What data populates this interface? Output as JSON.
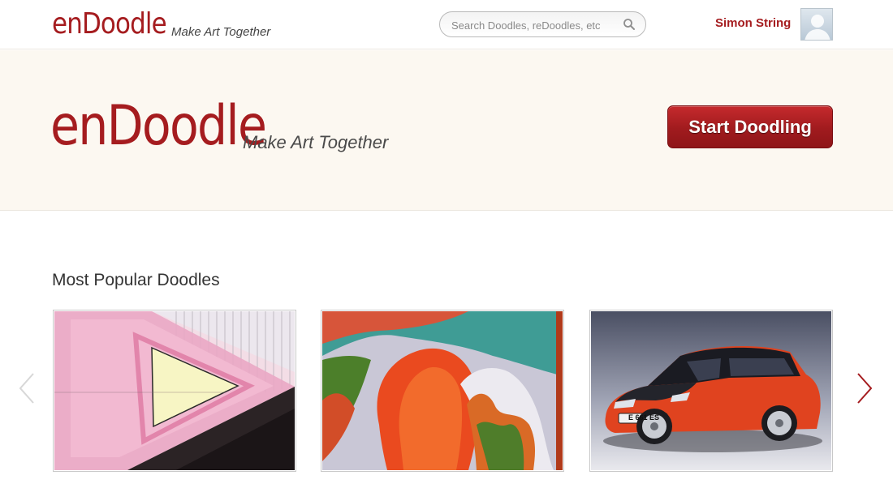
{
  "header": {
    "logo": "enDoodle",
    "tagline": "Make Art Together",
    "search_placeholder": "Search Doodles, reDoodles, etc",
    "user_name": "Simon String"
  },
  "hero": {
    "logo": "enDoodle",
    "tagline": "Make Art Together",
    "cta_label": "Start Doodling"
  },
  "popular": {
    "title": "Most Popular Doodles",
    "car_plate": "E 661 ES"
  },
  "colors": {
    "brand_red": "#a51c1f",
    "hero_bg": "#fcf8f1"
  },
  "icons": {
    "search": "search-icon",
    "prev": "chevron-left-icon",
    "next": "chevron-right-icon"
  }
}
